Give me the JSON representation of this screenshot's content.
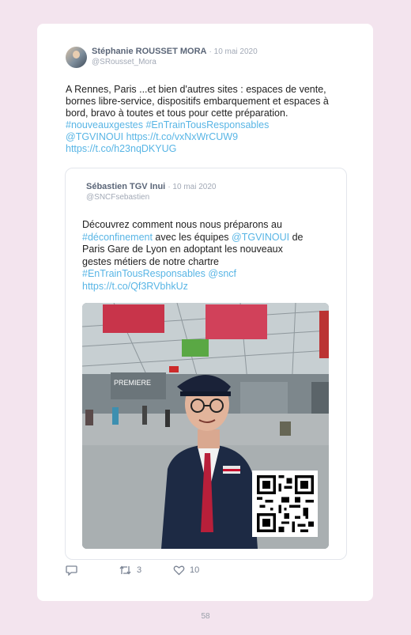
{
  "tweet": {
    "author_name": "Stéphanie ROUSSET MORA",
    "date": "· 10 mai 2020",
    "handle": "@SRousset_Mora",
    "text_lines": [
      "A Rennes, Paris ...et bien d'autres sites : espaces de vente,",
      "bornes libre-service, dispositifs embarquement et espaces à",
      "bord, bravo à toutes et tous pour cette préparation."
    ],
    "hashtags": "#nouveauxgestes #EnTrainTousResponsables",
    "mention_and_link": "@TGVINOUI https://t.co/vxNxWrCUW9",
    "link2": "https://t.co/h23nqDKYUG"
  },
  "quoted_tweet": {
    "author_name": "Sébastien TGV Inui",
    "date": "· 10 mai 2020",
    "handle": "@SNCFsebastien",
    "line1": "Découvrez comment nous nous préparons au",
    "hashtag_deconfinement": "#déconfinement",
    "line2_mid": " avec les équipes ",
    "mention_tgvinoui": "@TGVINOUI",
    "line2_end": " de",
    "line3": "Paris Gare de Lyon en adoptant les nouveaux",
    "line4": "gestes métiers de notre chartre",
    "hashtag_entrain": "#EnTrainTousResponsables",
    "mention_sncf": "@sncf",
    "link": "https://t.co/Qf3RVbhkUz",
    "media_alt_sign": "PREMIERE"
  },
  "actions": {
    "reply_icon": "reply-icon",
    "retweet_icon": "retweet-icon",
    "retweet_count": "3",
    "like_icon": "heart-icon",
    "like_count": "10"
  },
  "page_number": "58",
  "colors": {
    "background": "#f3e4ee",
    "link": "#58b5e5",
    "author": "#5b6678",
    "muted": "#a2a9b6"
  }
}
